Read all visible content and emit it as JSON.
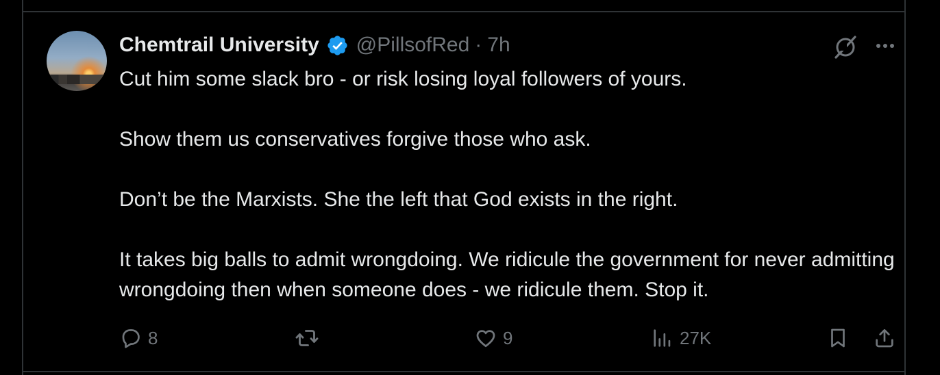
{
  "tweet": {
    "author_name": "Chemtrail University",
    "handle": "@PillsofRed",
    "separator": "·",
    "time": "7h",
    "verified": true,
    "paragraphs": [
      "Cut him some slack bro - or risk losing loyal followers of yours.",
      "Show them us conservatives forgive those who ask.",
      "Don’t be the Marxists. She the left that God exists in the right.",
      "It takes big balls to admit wrongdoing. We ridicule the government for never admitting wrongdoing then when someone does - we ridicule them. Stop it."
    ]
  },
  "actions": {
    "reply_count": "8",
    "like_count": "9",
    "views_count": "27K"
  },
  "icons": {
    "avatar": "avatar-image",
    "verified": "verified-badge-icon",
    "grok": "grok-icon",
    "more": "more-icon",
    "reply": "reply-icon",
    "repost": "repost-icon",
    "like": "heart-icon",
    "views": "views-icon",
    "bookmark": "bookmark-icon",
    "share": "share-icon"
  },
  "colors": {
    "background": "#000000",
    "text": "#e7e9ea",
    "muted": "#71767b",
    "divider": "#2f3336",
    "verified": "#1d9bf0"
  }
}
